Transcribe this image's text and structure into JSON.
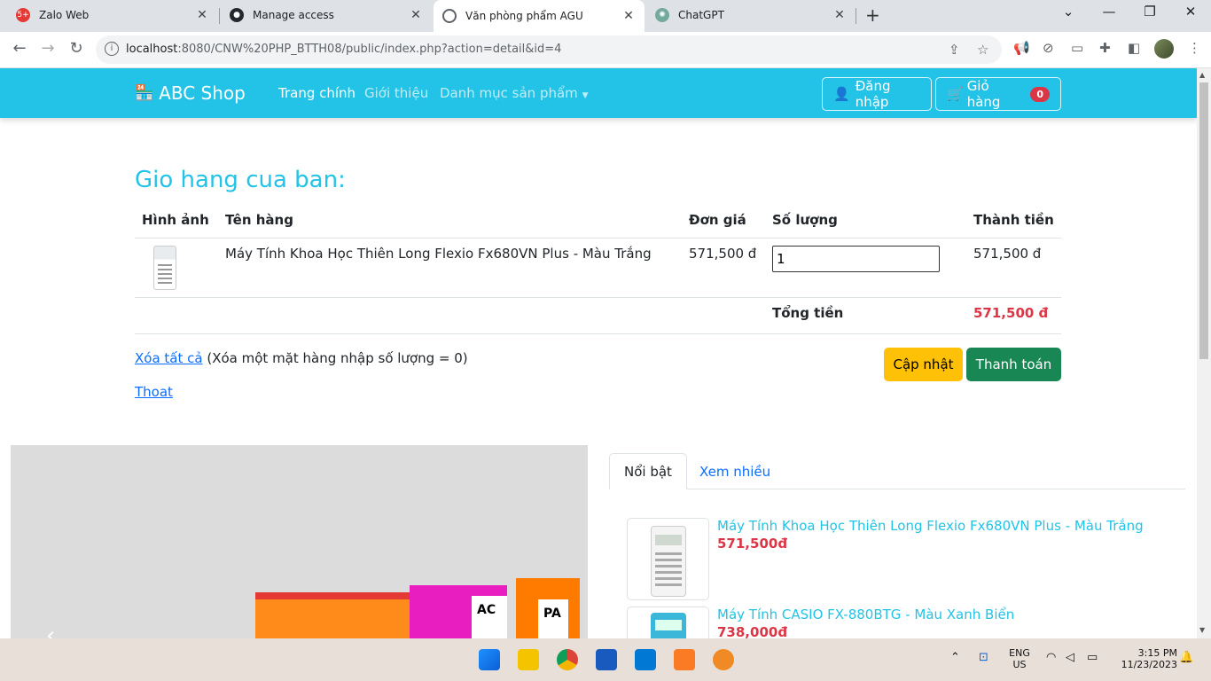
{
  "browser": {
    "tabs": [
      {
        "title": "Zalo Web",
        "icon": "zalo-icon",
        "badge": "5+"
      },
      {
        "title": "Manage access",
        "icon": "github-icon"
      },
      {
        "title": "Văn phòng phẩm AGU",
        "icon": "globe-icon"
      },
      {
        "title": "ChatGPT",
        "icon": "chatgpt-icon"
      }
    ],
    "url_host": "localhost",
    "url_rest": ":8080/CNW%20PHP_BTTH08/public/index.php?action=detail&id=4"
  },
  "navbar": {
    "brand": "ABC Shop",
    "links": [
      "Trang chính",
      "Giới thiệu",
      "Danh mục sản phẩm"
    ],
    "login": "Đăng nhập",
    "cart": "Giỏ hàng",
    "cart_count": "0"
  },
  "cart": {
    "title": "Gio hang cua ban:",
    "headers": [
      "Hình ảnh",
      "Tên hàng",
      "Đơn giá",
      "Số lượng",
      "Thành tiền"
    ],
    "rows": [
      {
        "name": "Máy Tính Khoa Học Thiên Long Flexio Fx680VN Plus - Màu Trắng",
        "price": "571,500 đ",
        "qty": "1",
        "subtotal": "571,500 đ"
      }
    ],
    "total_label": "Tổng tiền",
    "total_value": "571,500 đ",
    "clear_link": "Xóa tất cả",
    "clear_note": "(Xóa một mặt hàng nhập số lượng = 0)",
    "logout": "Thoat",
    "update_btn": "Cập nhật",
    "pay_btn": "Thanh toán"
  },
  "side": {
    "tabs": [
      "Nổi bật",
      "Xem nhiều"
    ],
    "items": [
      {
        "name": "Máy Tính Khoa Học Thiên Long Flexio Fx680VN Plus - Màu Trắng",
        "price": "571,500đ"
      },
      {
        "name": "Máy Tính CASIO FX-880BTG - Màu Xanh Biển",
        "price": "738,000đ"
      }
    ]
  },
  "carousel": {
    "binder_labels": [
      "AC",
      "PA"
    ]
  },
  "taskbar": {
    "lang": "ENG",
    "region": "US",
    "time": "3:15 PM",
    "date": "11/23/2023"
  }
}
